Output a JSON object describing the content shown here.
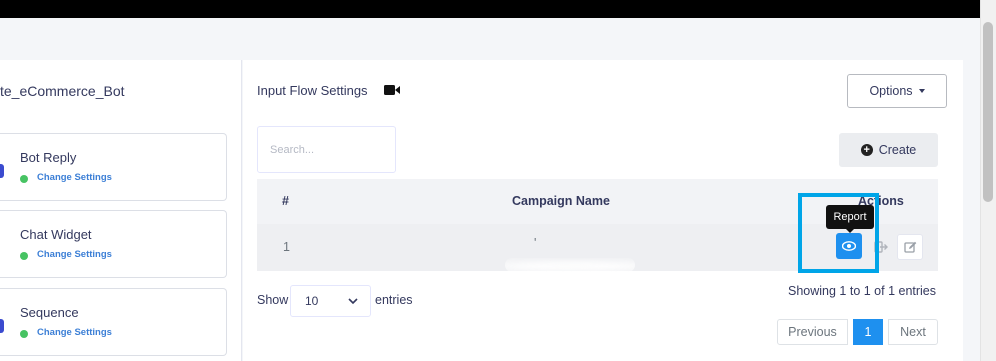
{
  "bot": {
    "name": "te_eCommerce_Bot",
    "items": [
      {
        "title": "Bot Reply",
        "link": "Change Settings"
      },
      {
        "title": "Chat Widget",
        "link": "Change Settings"
      },
      {
        "title": "Sequence",
        "link": "Change Settings"
      }
    ]
  },
  "main": {
    "heading": "Input Flow Settings",
    "heading_icon": "video-camera-icon",
    "options_label": "Options",
    "search_placeholder": "Search...",
    "create_label": "Create",
    "table": {
      "columns": [
        "#",
        "Campaign Name",
        "Actions"
      ],
      "rows": [
        {
          "index": "1",
          "campaign_name": "'"
        }
      ]
    },
    "tooltip": "Report",
    "show_label": "Show",
    "page_length": "10",
    "entries_label": "entries",
    "info": "Showing 1 to 1 of 1 entries",
    "pagination": {
      "previous": "Previous",
      "current": "1",
      "next": "Next"
    }
  },
  "colors": {
    "accent": "#1e90ef",
    "highlight": "#00a5e8",
    "status_green": "#47c363"
  }
}
